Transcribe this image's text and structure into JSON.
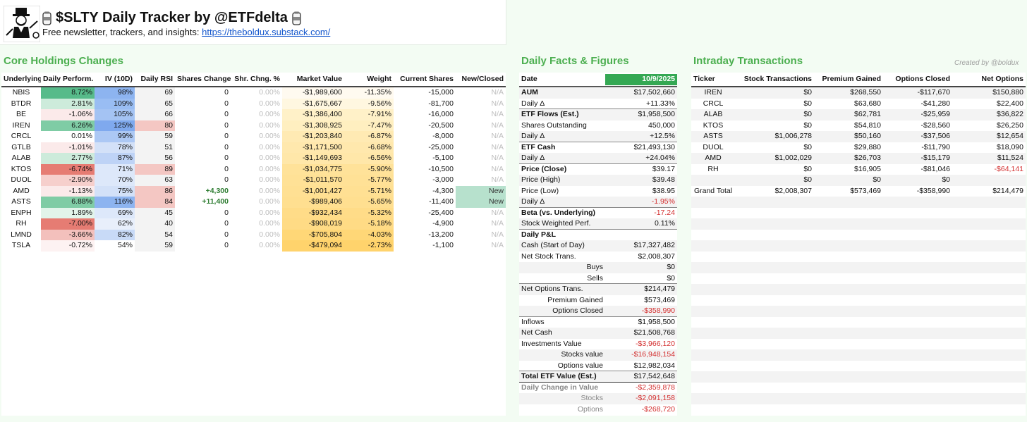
{
  "header": {
    "title": "$SLTY Daily Tracker by @ETFdelta",
    "subtitle": "Free newsletter, trackers, and insights:",
    "link": "https://theboldux.substack.com/"
  },
  "core": {
    "title": "Core Holdings Changes",
    "columns": [
      "Underlying",
      "Daily Perform.",
      "IV (10D)",
      "Daily RSI",
      "Shares Change",
      "Shr. Chng. %",
      "Market Value",
      "Weight",
      "Current Shares",
      "New/Closed"
    ],
    "rows": [
      {
        "ticker": "NBIS",
        "perf": "8.72%",
        "iv": "98%",
        "rsi": "69",
        "chg": "0",
        "chgpct": "0.00%",
        "mv": "-$1,989,600",
        "weight": "-11.35%",
        "shares": "-15,000",
        "status": "N/A",
        "perfColor": "#57bb8a",
        "ivColor": "#8db4f0",
        "rsiColor": "#f3f3f3",
        "mvColor": "#fffaf0",
        "wColor": "#fffaf0"
      },
      {
        "ticker": "BTDR",
        "perf": "2.81%",
        "iv": "109%",
        "rsi": "65",
        "chg": "0",
        "chgpct": "0.00%",
        "mv": "-$1,675,667",
        "weight": "-9.56%",
        "shares": "-81,700",
        "status": "N/A",
        "perfColor": "#cdebdb",
        "ivColor": "#99bdf3",
        "rsiColor": "#f3f3f3",
        "mvColor": "#fff7e0",
        "wColor": "#fff7e0"
      },
      {
        "ticker": "BE",
        "perf": "-1.06%",
        "iv": "105%",
        "rsi": "66",
        "chg": "0",
        "chgpct": "0.00%",
        "mv": "-$1,386,400",
        "weight": "-7.91%",
        "shares": "-16,000",
        "status": "N/A",
        "perfColor": "#fbeaea",
        "ivColor": "#a4c3f3",
        "rsiColor": "#f3f3f3",
        "mvColor": "#fff1c8",
        "wColor": "#fff1c8"
      },
      {
        "ticker": "IREN",
        "perf": "6.26%",
        "iv": "125%",
        "rsi": "80",
        "chg": "0",
        "chgpct": "0.00%",
        "mv": "-$1,308,925",
        "weight": "-7.47%",
        "shares": "-20,500",
        "status": "N/A",
        "perfColor": "#7fcca5",
        "ivColor": "#7fa9ee",
        "rsiColor": "#f4c7c3",
        "mvColor": "#ffefc0",
        "wColor": "#ffefc0"
      },
      {
        "ticker": "CRCL",
        "perf": "0.01%",
        "iv": "99%",
        "rsi": "59",
        "chg": "0",
        "chgpct": "0.00%",
        "mv": "-$1,203,840",
        "weight": "-6.87%",
        "shares": "-8,000",
        "status": "N/A",
        "perfColor": "#ffffff",
        "ivColor": "#acc8f4",
        "rsiColor": "#f3f3f3",
        "mvColor": "#ffeab3",
        "wColor": "#ffeab3"
      },
      {
        "ticker": "GTLB",
        "perf": "-1.01%",
        "iv": "78%",
        "rsi": "51",
        "chg": "0",
        "chgpct": "0.00%",
        "mv": "-$1,171,500",
        "weight": "-6.68%",
        "shares": "-25,000",
        "status": "N/A",
        "perfColor": "#fbeaea",
        "ivColor": "#d3e1f8",
        "rsiColor": "#f3f3f3",
        "mvColor": "#ffe8ad",
        "wColor": "#ffe8ad"
      },
      {
        "ticker": "ALAB",
        "perf": "2.77%",
        "iv": "87%",
        "rsi": "56",
        "chg": "0",
        "chgpct": "0.00%",
        "mv": "-$1,149,693",
        "weight": "-6.56%",
        "shares": "-5,100",
        "status": "N/A",
        "perfColor": "#cdebdb",
        "ivColor": "#bed3f6",
        "rsiColor": "#f3f3f3",
        "mvColor": "#ffe7a9",
        "wColor": "#ffe7a9"
      },
      {
        "ticker": "KTOS",
        "perf": "-6.74%",
        "iv": "71%",
        "rsi": "89",
        "chg": "0",
        "chgpct": "0.00%",
        "mv": "-$1,034,775",
        "weight": "-5.90%",
        "shares": "-10,500",
        "status": "N/A",
        "perfColor": "#e67c73",
        "ivColor": "#dde8fa",
        "rsiColor": "#f4c7c3",
        "mvColor": "#ffe299",
        "wColor": "#ffe299"
      },
      {
        "ticker": "DUOL",
        "perf": "-2.90%",
        "iv": "70%",
        "rsi": "63",
        "chg": "0",
        "chgpct": "0.00%",
        "mv": "-$1,011,570",
        "weight": "-5.77%",
        "shares": "-3,000",
        "status": "N/A",
        "perfColor": "#f6cfcc",
        "ivColor": "#dde8fa",
        "rsiColor": "#f3f3f3",
        "mvColor": "#ffe196",
        "wColor": "#ffe196"
      },
      {
        "ticker": "AMD",
        "perf": "-1.13%",
        "iv": "75%",
        "rsi": "86",
        "chg": "+4,300",
        "chgpct": "0.00%",
        "mv": "-$1,001,427",
        "weight": "-5.71%",
        "shares": "-4,300",
        "status": "New",
        "perfColor": "#fbeaea",
        "ivColor": "#d3e1f8",
        "rsiColor": "#f4c7c3",
        "mvColor": "#ffe093",
        "wColor": "#ffe093"
      },
      {
        "ticker": "ASTS",
        "perf": "6.88%",
        "iv": "116%",
        "rsi": "84",
        "chg": "+11,400",
        "chgpct": "0.00%",
        "mv": "-$989,406",
        "weight": "-5.65%",
        "shares": "-11,400",
        "status": "New",
        "perfColor": "#7fcca5",
        "ivColor": "#8db4f0",
        "rsiColor": "#f4c7c3",
        "mvColor": "#ffdf90",
        "wColor": "#ffdf90"
      },
      {
        "ticker": "ENPH",
        "perf": "1.89%",
        "iv": "69%",
        "rsi": "45",
        "chg": "0",
        "chgpct": "0.00%",
        "mv": "-$932,434",
        "weight": "-5.32%",
        "shares": "-25,400",
        "status": "N/A",
        "perfColor": "#e2f4ea",
        "ivColor": "#dde8fa",
        "rsiColor": "#f3f3f3",
        "mvColor": "#ffdc88",
        "wColor": "#ffdc88"
      },
      {
        "ticker": "RH",
        "perf": "-7.00%",
        "iv": "62%",
        "rsi": "40",
        "chg": "0",
        "chgpct": "0.00%",
        "mv": "-$908,019",
        "weight": "-5.18%",
        "shares": "-4,900",
        "status": "N/A",
        "perfColor": "#e67c73",
        "ivColor": "#e8effb",
        "rsiColor": "#f3f3f3",
        "mvColor": "#ffdb85",
        "wColor": "#ffdb85"
      },
      {
        "ticker": "LMND",
        "perf": "-3.66%",
        "iv": "82%",
        "rsi": "54",
        "chg": "0",
        "chgpct": "0.00%",
        "mv": "-$705,804",
        "weight": "-4.03%",
        "shares": "-13,200",
        "status": "N/A",
        "perfColor": "#f3c0bc",
        "ivColor": "#c8daf7",
        "rsiColor": "#f3f3f3",
        "mvColor": "#ffd777",
        "wColor": "#ffd777"
      },
      {
        "ticker": "TSLA",
        "perf": "-0.72%",
        "iv": "54%",
        "rsi": "59",
        "chg": "0",
        "chgpct": "0.00%",
        "mv": "-$479,094",
        "weight": "-2.73%",
        "shares": "-1,100",
        "status": "N/A",
        "perfColor": "#fdf2f2",
        "ivColor": "#ffffff",
        "rsiColor": "#f3f3f3",
        "mvColor": "#ffd36c",
        "wColor": "#ffd36c"
      }
    ]
  },
  "facts": {
    "title": "Daily Facts & Figures",
    "date_label": "Date",
    "date_value": "10/9/2025",
    "rows": [
      {
        "label": "AUM",
        "value": "$17,502,660",
        "style": "bold",
        "sep": true
      },
      {
        "label": "Daily Δ",
        "value": "+11.33%"
      },
      {
        "label": "ETF Flows (Est.)",
        "value": "$1,958,500",
        "style": "bold",
        "sep": true
      },
      {
        "label": "Shares Outstanding",
        "value": "450,000"
      },
      {
        "label": "Daily Δ",
        "value": "+12.5%"
      },
      {
        "label": "ETF Cash",
        "value": "$21,493,130",
        "style": "bold",
        "sep": true
      },
      {
        "label": "Daily Δ",
        "value": "+24.04%"
      },
      {
        "label": "Price (Close)",
        "value": "$39.17",
        "style": "bold",
        "sep": true
      },
      {
        "label": "Price (High)",
        "value": "$39.48"
      },
      {
        "label": "Price (Low)",
        "value": "$38.95"
      },
      {
        "label": "Daily Δ",
        "value": "-1.95%",
        "neg": true
      },
      {
        "label": "Beta (vs. Underlying)",
        "value": "-17.24",
        "style": "bold",
        "neg": true,
        "sep": true
      },
      {
        "label": "Stock Weighted Perf.",
        "value": "0.11%"
      },
      {
        "label": "Daily P&L",
        "value": "",
        "style": "bold",
        "sep": true
      },
      {
        "label": "Cash (Start of Day)",
        "value": "$17,327,482"
      },
      {
        "label": "Net Stock Trans.",
        "value": "$2,008,307"
      },
      {
        "label": "Buys",
        "value": "$0",
        "indent": true
      },
      {
        "label": "Sells",
        "value": "$0",
        "indent": true
      },
      {
        "label": "Net Options Trans.",
        "value": "$214,479",
        "sep": true
      },
      {
        "label": "Premium Gained",
        "value": "$573,469",
        "indent": true
      },
      {
        "label": "Options Closed",
        "value": "-$358,990",
        "indent": true,
        "neg": true
      },
      {
        "label": "Inflows",
        "value": "$1,958,500",
        "sep": true
      },
      {
        "label": "Net Cash",
        "value": "$21,508,768"
      },
      {
        "label": "Investments Value",
        "value": "-$3,966,120",
        "neg": true
      },
      {
        "label": "Stocks value",
        "value": "-$16,948,154",
        "indent": true,
        "neg": true
      },
      {
        "label": "Options value",
        "value": "$12,982,034",
        "indent": true
      },
      {
        "label": "Total ETF Value (Est.)",
        "value": "$17,542,648",
        "style": "bold",
        "sep": true
      },
      {
        "label": "Daily Change in Value",
        "value": "-$2,359,878",
        "style": "graybold",
        "neg": true,
        "thick": true
      },
      {
        "label": "Stocks",
        "value": "-$2,091,158",
        "indent": true,
        "gray": true,
        "neg": true
      },
      {
        "label": "Options",
        "value": "-$268,720",
        "indent": true,
        "gray": true,
        "neg": true
      }
    ]
  },
  "intraday": {
    "title": "Intraday Transactions",
    "created": "Created by @boldux",
    "columns": [
      "Ticker",
      "Stock Transactions",
      "Premium Gained",
      "Options Closed",
      "Net Options"
    ],
    "rows": [
      {
        "ticker": "IREN",
        "stock": "$0",
        "prem": "$268,550",
        "closed": "-$117,670",
        "net": "$150,880"
      },
      {
        "ticker": "CRCL",
        "stock": "$0",
        "prem": "$63,680",
        "closed": "-$41,280",
        "net": "$22,400"
      },
      {
        "ticker": "ALAB",
        "stock": "$0",
        "prem": "$62,781",
        "closed": "-$25,959",
        "net": "$36,822"
      },
      {
        "ticker": "KTOS",
        "stock": "$0",
        "prem": "$54,810",
        "closed": "-$28,560",
        "net": "$26,250"
      },
      {
        "ticker": "ASTS",
        "stock": "$1,006,278",
        "prem": "$50,160",
        "closed": "-$37,506",
        "net": "$12,654"
      },
      {
        "ticker": "DUOL",
        "stock": "$0",
        "prem": "$29,880",
        "closed": "-$11,790",
        "net": "$18,090"
      },
      {
        "ticker": "AMD",
        "stock": "$1,002,029",
        "prem": "$26,703",
        "closed": "-$15,179",
        "net": "$11,524"
      },
      {
        "ticker": "RH",
        "stock": "$0",
        "prem": "$16,905",
        "closed": "-$81,046",
        "net": "-$64,141",
        "netNeg": true
      },
      {
        "ticker": "",
        "stock": "$0",
        "prem": "$0",
        "closed": "$0",
        "net": ""
      },
      {
        "ticker": "Grand Total",
        "stock": "$2,008,307",
        "prem": "$573,469",
        "closed": "-$358,990",
        "net": "$214,479"
      }
    ]
  }
}
